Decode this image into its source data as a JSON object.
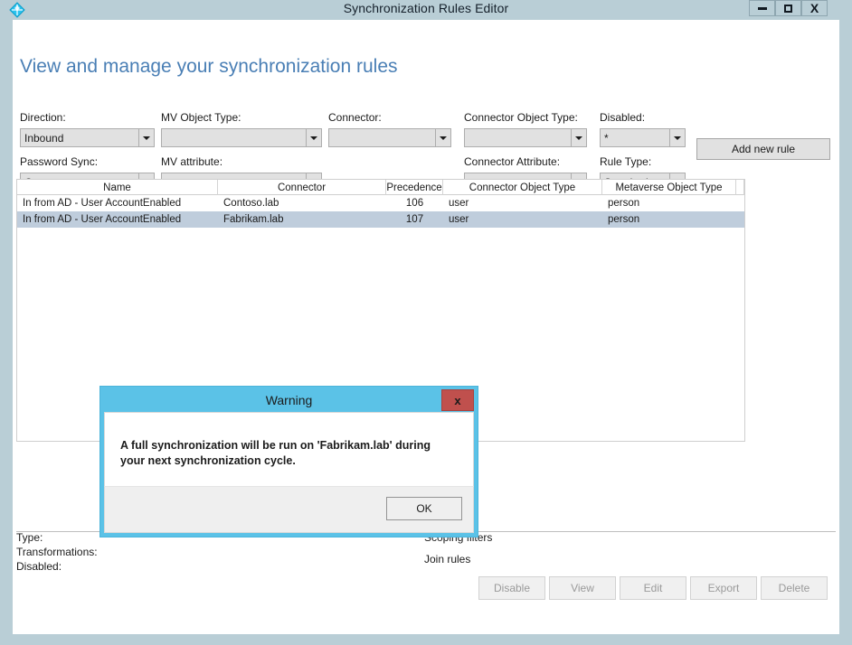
{
  "window": {
    "title": "Synchronization Rules Editor",
    "icon": "sync-diamond-icon",
    "controls": {
      "minimize": "–",
      "maximize": "□",
      "close": "X"
    },
    "frame_color": "#b9ced6"
  },
  "page": {
    "heading": "View and manage your synchronization rules",
    "heading_color": "#4a7fb5"
  },
  "filters": [
    {
      "label": "Direction:",
      "value": "Inbound",
      "name": "direction"
    },
    {
      "label": "MV Object Type:",
      "value": "",
      "name": "mv-object-type"
    },
    {
      "label": "Connector:",
      "value": "",
      "name": "connector"
    },
    {
      "label": "Connector Object Type:",
      "value": "",
      "name": "connector-object-type"
    },
    {
      "label": "Disabled:",
      "value": "*",
      "name": "disabled"
    },
    {
      "label": "Password Sync:",
      "value": "On",
      "name": "password-sync"
    },
    {
      "label": "MV attribute:",
      "value": "",
      "name": "mv-attribute"
    },
    {
      "label": "Connector Attribute:",
      "value": "",
      "name": "connector-attribute"
    },
    {
      "label": "Rule Type:",
      "value": "Standard",
      "name": "rule-type"
    }
  ],
  "toolbar": {
    "add_new_rule": "Add new rule"
  },
  "grid": {
    "columns": [
      "Name",
      "Connector",
      "Precedence",
      "Connector Object Type",
      "Metaverse Object Type"
    ],
    "rows": [
      {
        "name": "In from AD - User AccountEnabled",
        "connector": "Contoso.lab",
        "precedence": "106",
        "connector_object_type": "user",
        "metaverse_object_type": "person",
        "selected": false
      },
      {
        "name": "In from AD - User AccountEnabled",
        "connector": "Fabrikam.lab",
        "precedence": "107",
        "connector_object_type": "user",
        "metaverse_object_type": "person",
        "selected": true
      }
    ],
    "selected_row_color": "#bfcddc"
  },
  "details": {
    "left": [
      "Type:",
      "Transformations:",
      "Disabled:"
    ],
    "right": [
      "Scoping filters",
      "Join rules"
    ]
  },
  "actions": [
    {
      "label": "Disable",
      "name": "disable"
    },
    {
      "label": "View",
      "name": "view"
    },
    {
      "label": "Edit",
      "name": "edit"
    },
    {
      "label": "Export",
      "name": "export"
    },
    {
      "label": "Delete",
      "name": "delete"
    }
  ],
  "dialog": {
    "title": "Warning",
    "close_label": "x",
    "message": "A full synchronization will be run on 'Fabrikam.lab' during your next synchronization cycle.",
    "ok_label": "OK",
    "header_color": "#5bc2e7",
    "close_color": "#c0504d"
  }
}
